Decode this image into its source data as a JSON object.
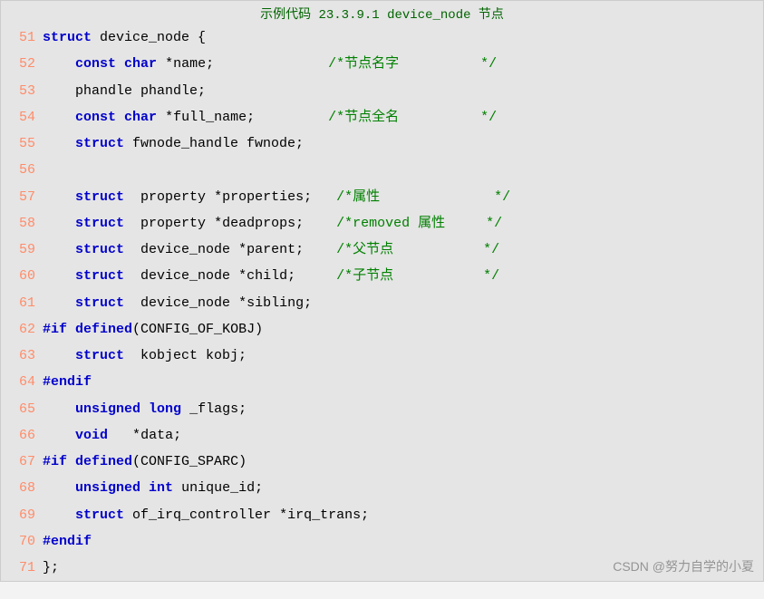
{
  "title": "示例代码 23.3.9.1 device_node 节点",
  "watermark": "CSDN @努力自学的小夏",
  "lines": [
    {
      "n": "51",
      "ind": "",
      "tokens": [
        {
          "c": "kw",
          "t": "struct"
        },
        {
          "c": "",
          "t": " device_node "
        },
        {
          "c": "brace",
          "t": "{"
        }
      ]
    },
    {
      "n": "52",
      "ind": "    ",
      "tokens": [
        {
          "c": "kw",
          "t": "const"
        },
        {
          "c": "",
          "t": " "
        },
        {
          "c": "kw",
          "t": "char"
        },
        {
          "c": "",
          "t": " "
        },
        {
          "c": "star",
          "t": "*"
        },
        {
          "c": "",
          "t": "name;"
        }
      ],
      "cmt": "/*节点名字          */",
      "pad": "              "
    },
    {
      "n": "53",
      "ind": "    ",
      "tokens": [
        {
          "c": "",
          "t": "phandle phandle;"
        }
      ]
    },
    {
      "n": "54",
      "ind": "    ",
      "tokens": [
        {
          "c": "kw",
          "t": "const"
        },
        {
          "c": "",
          "t": " "
        },
        {
          "c": "kw",
          "t": "char"
        },
        {
          "c": "",
          "t": " "
        },
        {
          "c": "star",
          "t": "*"
        },
        {
          "c": "",
          "t": "full_name;"
        }
      ],
      "cmt": "/*节点全名          */",
      "pad": "         "
    },
    {
      "n": "55",
      "ind": "    ",
      "tokens": [
        {
          "c": "kw",
          "t": "struct"
        },
        {
          "c": "",
          "t": " fwnode_handle fwnode;"
        }
      ]
    },
    {
      "n": "56",
      "ind": "",
      "tokens": []
    },
    {
      "n": "57",
      "ind": "    ",
      "tokens": [
        {
          "c": "kw",
          "t": "struct"
        },
        {
          "c": "",
          "t": "  property "
        },
        {
          "c": "star",
          "t": "*"
        },
        {
          "c": "",
          "t": "properties;"
        }
      ],
      "cmt": "/*属性              */",
      "pad": "   "
    },
    {
      "n": "58",
      "ind": "    ",
      "tokens": [
        {
          "c": "kw",
          "t": "struct"
        },
        {
          "c": "",
          "t": "  property "
        },
        {
          "c": "star",
          "t": "*"
        },
        {
          "c": "",
          "t": "deadprops;"
        }
      ],
      "cmt": "/*removed 属性     */",
      "pad": "    "
    },
    {
      "n": "59",
      "ind": "    ",
      "tokens": [
        {
          "c": "kw",
          "t": "struct"
        },
        {
          "c": "",
          "t": "  device_node "
        },
        {
          "c": "star",
          "t": "*"
        },
        {
          "c": "",
          "t": "parent;"
        }
      ],
      "cmt": "/*父节点           */",
      "pad": "    "
    },
    {
      "n": "60",
      "ind": "    ",
      "tokens": [
        {
          "c": "kw",
          "t": "struct"
        },
        {
          "c": "",
          "t": "  device_node "
        },
        {
          "c": "star",
          "t": "*"
        },
        {
          "c": "",
          "t": "child;"
        }
      ],
      "cmt": "/*子节点           */",
      "pad": "     "
    },
    {
      "n": "61",
      "ind": "    ",
      "tokens": [
        {
          "c": "kw",
          "t": "struct"
        },
        {
          "c": "",
          "t": "  device_node "
        },
        {
          "c": "star",
          "t": "*"
        },
        {
          "c": "",
          "t": "sibling;"
        }
      ]
    },
    {
      "n": "62",
      "ind": "",
      "tokens": [
        {
          "c": "kw",
          "t": "#if"
        },
        {
          "c": "",
          "t": " "
        },
        {
          "c": "kw",
          "t": "defined"
        },
        {
          "c": "",
          "t": "(CONFIG_OF_KOBJ)"
        }
      ]
    },
    {
      "n": "63",
      "ind": "    ",
      "tokens": [
        {
          "c": "kw",
          "t": "struct"
        },
        {
          "c": "",
          "t": "  kobject kobj;"
        }
      ]
    },
    {
      "n": "64",
      "ind": "",
      "tokens": [
        {
          "c": "kw",
          "t": "#endif"
        }
      ]
    },
    {
      "n": "65",
      "ind": "    ",
      "tokens": [
        {
          "c": "kw",
          "t": "unsigned"
        },
        {
          "c": "",
          "t": " "
        },
        {
          "c": "kw",
          "t": "long"
        },
        {
          "c": "",
          "t": " _flags;"
        }
      ]
    },
    {
      "n": "66",
      "ind": "    ",
      "tokens": [
        {
          "c": "kw",
          "t": "void"
        },
        {
          "c": "",
          "t": "   "
        },
        {
          "c": "star",
          "t": "*"
        },
        {
          "c": "",
          "t": "data;"
        }
      ]
    },
    {
      "n": "67",
      "ind": "",
      "tokens": [
        {
          "c": "kw",
          "t": "#if"
        },
        {
          "c": "",
          "t": " "
        },
        {
          "c": "kw",
          "t": "defined"
        },
        {
          "c": "",
          "t": "(CONFIG_SPARC)"
        }
      ]
    },
    {
      "n": "68",
      "ind": "    ",
      "tokens": [
        {
          "c": "kw",
          "t": "unsigned"
        },
        {
          "c": "",
          "t": " "
        },
        {
          "c": "kw",
          "t": "int"
        },
        {
          "c": "",
          "t": " unique_id;"
        }
      ]
    },
    {
      "n": "69",
      "ind": "    ",
      "tokens": [
        {
          "c": "kw",
          "t": "struct"
        },
        {
          "c": "",
          "t": " of_irq_controller "
        },
        {
          "c": "star",
          "t": "*"
        },
        {
          "c": "",
          "t": "irq_trans;"
        }
      ]
    },
    {
      "n": "70",
      "ind": "",
      "tokens": [
        {
          "c": "kw",
          "t": "#endif"
        }
      ]
    },
    {
      "n": "71",
      "ind": "",
      "tokens": [
        {
          "c": "brace",
          "t": "};"
        }
      ]
    }
  ]
}
